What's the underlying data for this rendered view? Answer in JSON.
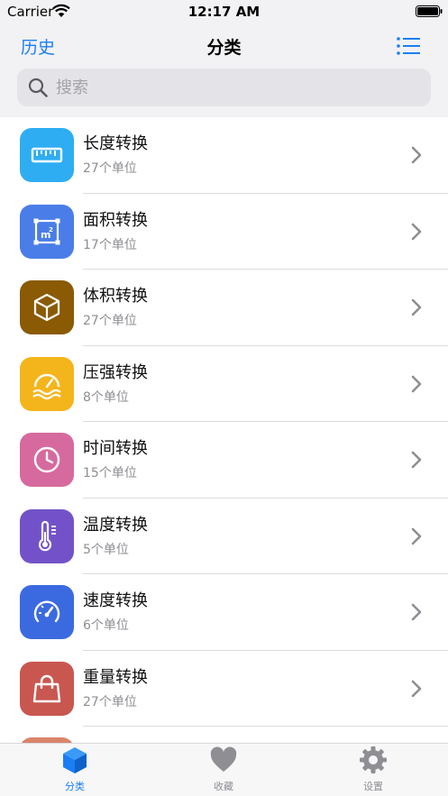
{
  "status_bar": {
    "carrier": "Carrier",
    "time": "12:17 AM"
  },
  "nav": {
    "history_label": "历史",
    "title": "分类"
  },
  "search": {
    "placeholder": "搜索",
    "value": ""
  },
  "categories": [
    {
      "title": "长度转换",
      "subtitle": "27个单位",
      "icon": "ruler-icon",
      "color": "#2eadf2"
    },
    {
      "title": "面积转换",
      "subtitle": "17个单位",
      "icon": "area-icon",
      "color": "#4a7de8"
    },
    {
      "title": "体积转换",
      "subtitle": "27个单位",
      "icon": "cube-icon",
      "color": "#8a5a04"
    },
    {
      "title": "压强转换",
      "subtitle": "8个单位",
      "icon": "pressure-gauge-icon",
      "color": "#f4b51c"
    },
    {
      "title": "时间转换",
      "subtitle": "15个单位",
      "icon": "clock-icon",
      "color": "#d66a9e"
    },
    {
      "title": "温度转换",
      "subtitle": "5个单位",
      "icon": "thermometer-icon",
      "color": "#7352c9"
    },
    {
      "title": "速度转换",
      "subtitle": "6个单位",
      "icon": "speedometer-icon",
      "color": "#3b6ae0"
    },
    {
      "title": "重量转换",
      "subtitle": "27个单位",
      "icon": "bag-icon",
      "color": "#c85750"
    }
  ],
  "tabs": [
    {
      "label": "分类",
      "icon": "cube-icon",
      "active": true
    },
    {
      "label": "收藏",
      "icon": "heart-icon",
      "active": false
    },
    {
      "label": "设置",
      "icon": "gear-icon",
      "active": false
    }
  ],
  "colors": {
    "accent": "#1a7ef5",
    "inactive_tab": "#8e8e93",
    "partial_row_icon": "#d9856a"
  }
}
